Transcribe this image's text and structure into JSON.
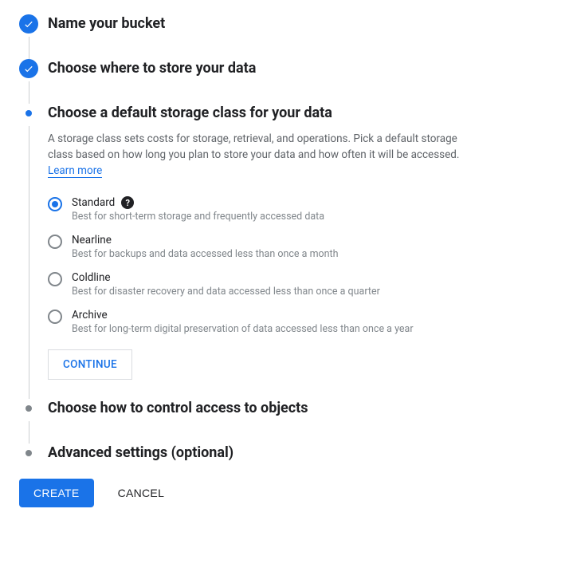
{
  "steps": {
    "s1": {
      "title": "Name your bucket"
    },
    "s2": {
      "title": "Choose where to store your data"
    },
    "s3": {
      "title": "Choose a default storage class for your data",
      "desc": "A storage class sets costs for storage, retrieval, and operations. Pick a default storage class based on how long you plan to store your data and how often it will be accessed.",
      "learn": "Learn more",
      "options": [
        {
          "label": "Standard",
          "sub": "Best for short-term storage and frequently accessed data",
          "help": "?"
        },
        {
          "label": "Nearline",
          "sub": "Best for backups and data accessed less than once a month"
        },
        {
          "label": "Coldline",
          "sub": "Best for disaster recovery and data accessed less than once a quarter"
        },
        {
          "label": "Archive",
          "sub": "Best for long-term digital preservation of data accessed less than once a year"
        }
      ],
      "continue": "CONTINUE"
    },
    "s4": {
      "title": "Choose how to control access to objects"
    },
    "s5": {
      "title": "Advanced settings (optional)"
    }
  },
  "footer": {
    "create": "CREATE",
    "cancel": "CANCEL"
  }
}
